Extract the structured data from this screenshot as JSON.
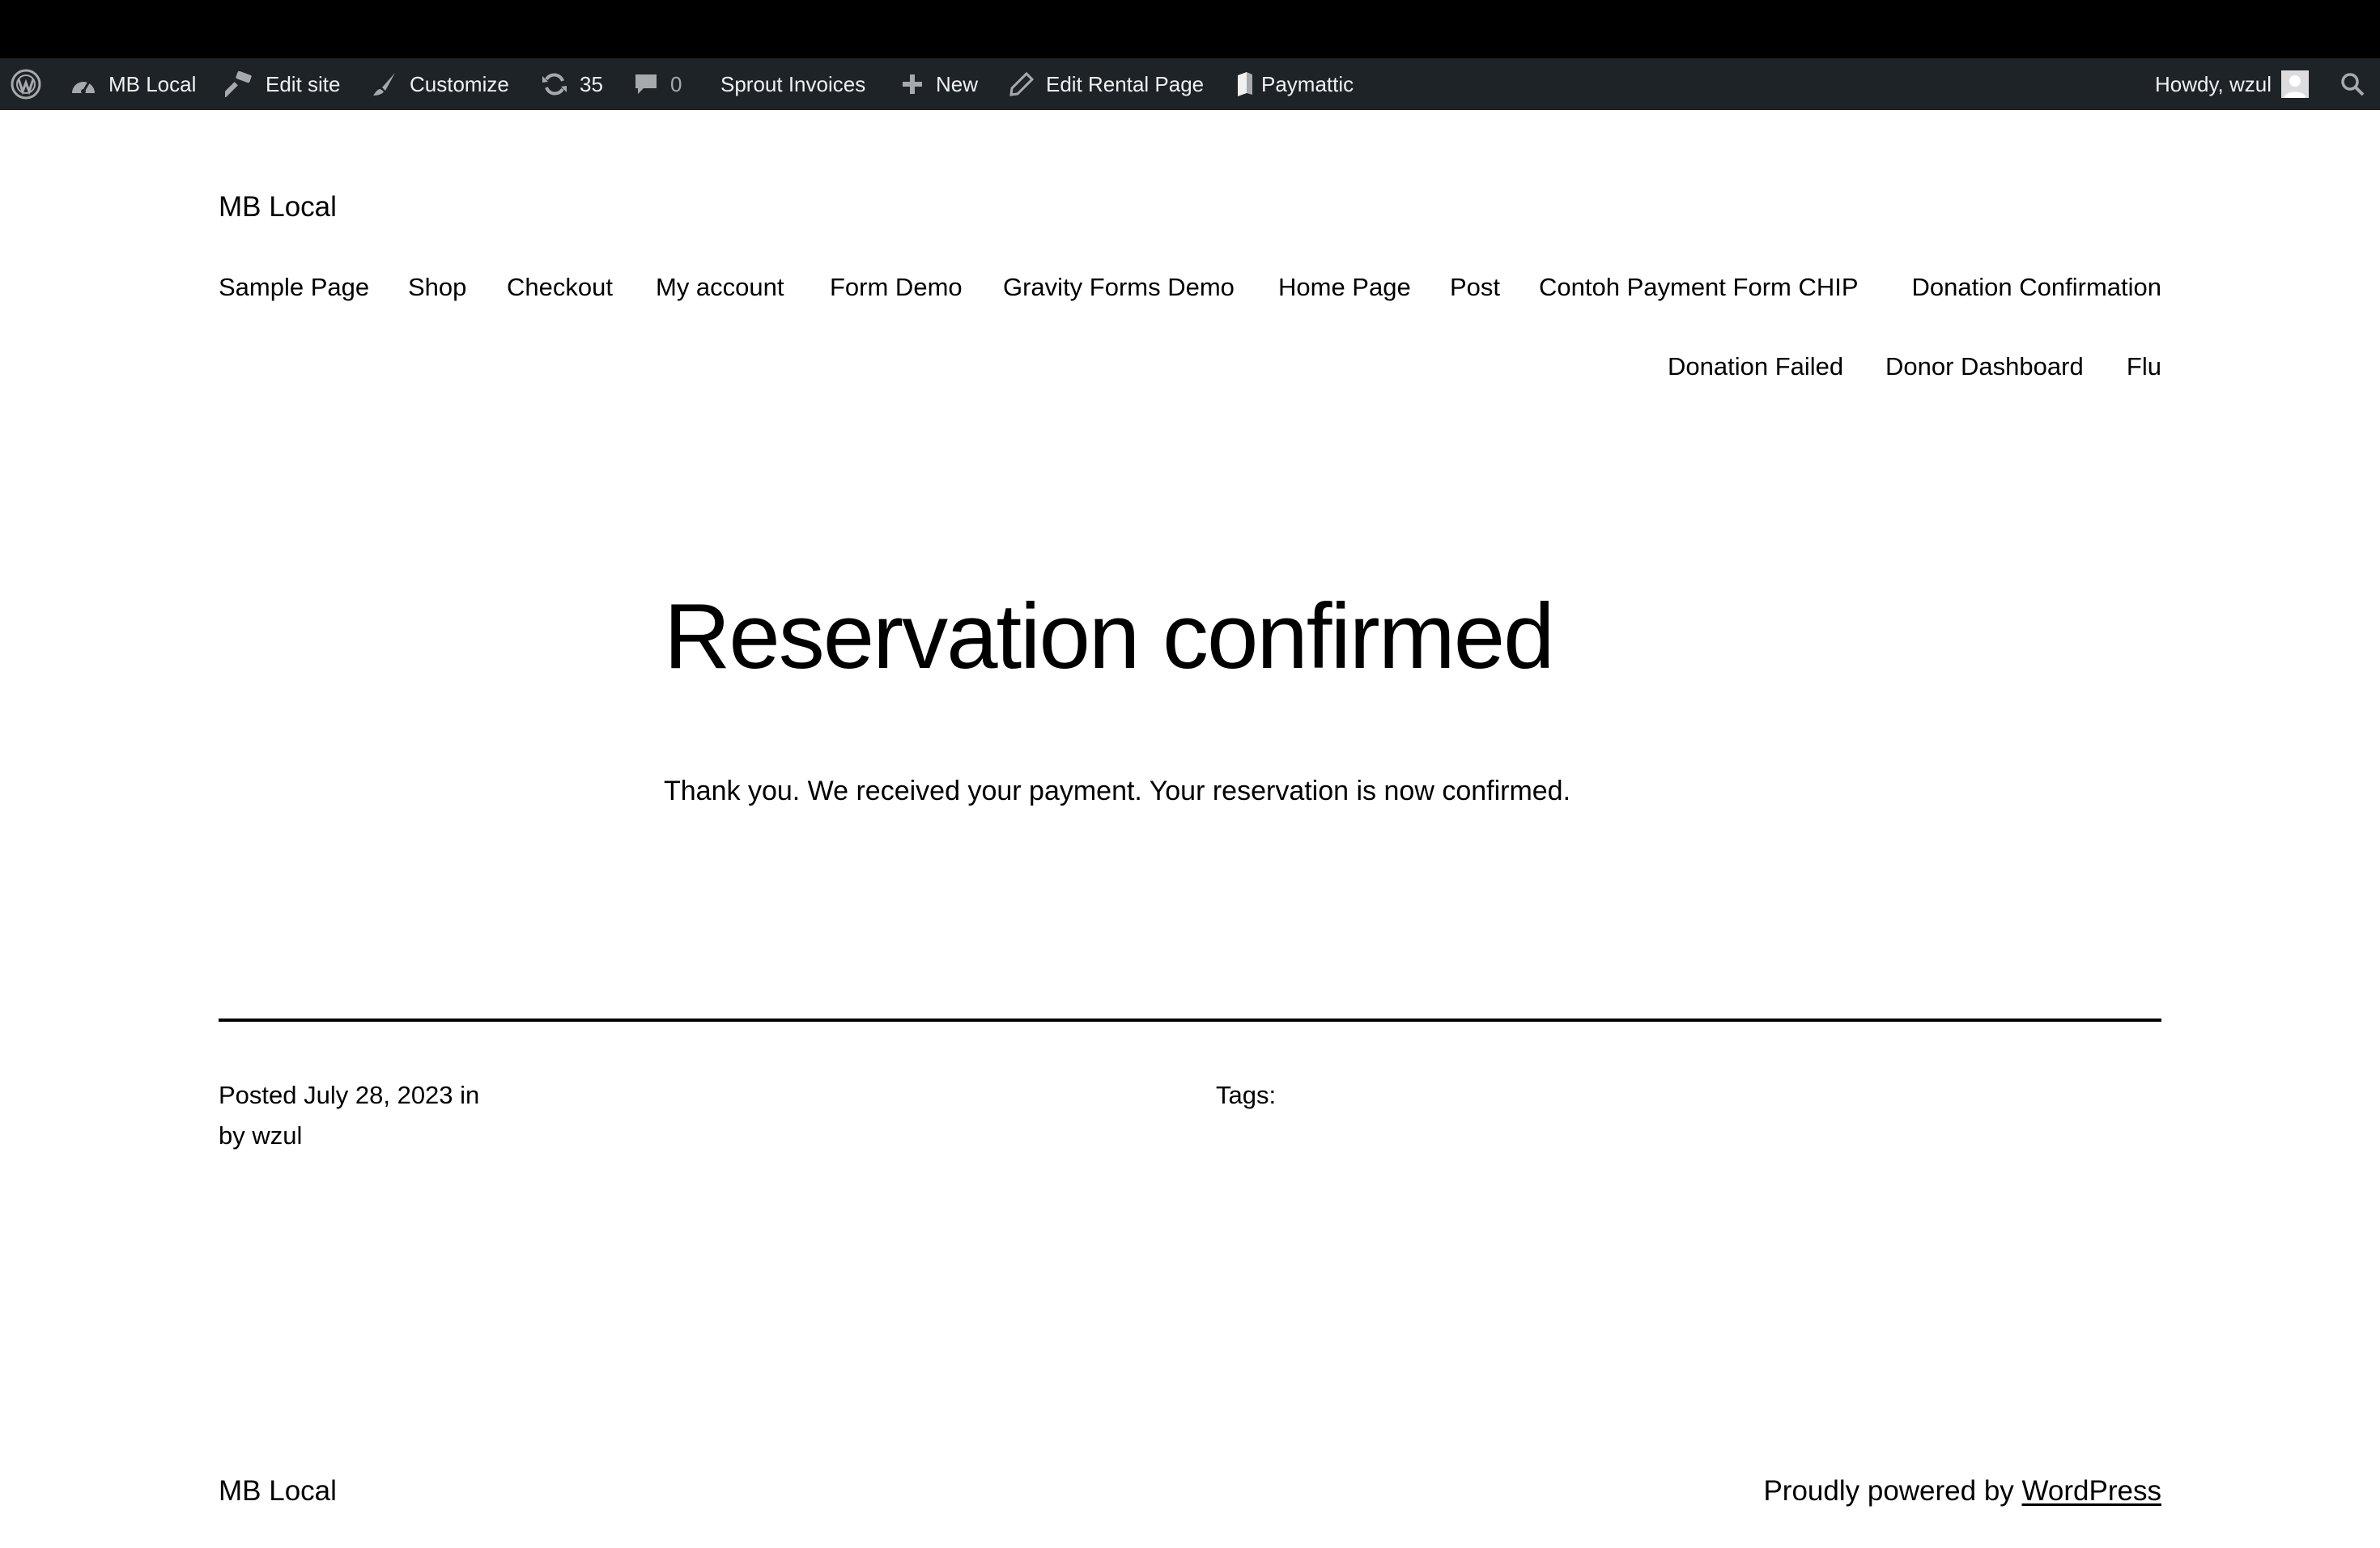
{
  "admin_bar": {
    "site_name": "MB Local",
    "edit_site": "Edit site",
    "customize": "Customize",
    "updates_count": "35",
    "comments_count": "0",
    "sprout_invoices": "Sprout Invoices",
    "new": "New",
    "edit_page": "Edit Rental Page",
    "paymattic": "Paymattic",
    "howdy": "Howdy, wzul"
  },
  "header": {
    "site_title": "MB Local",
    "nav": [
      "Sample Page",
      "Shop",
      "Checkout",
      "My account",
      "Form Demo",
      "Gravity Forms Demo",
      "Home Page",
      "Post",
      "Contoh Payment Form CHIP",
      "Donation Confirmation",
      "Donation Failed",
      "Donor Dashboard",
      "Flu"
    ]
  },
  "main": {
    "title": "Reservation confirmed",
    "body": "Thank you. We received your payment. Your reservation is now confirmed."
  },
  "post_meta": {
    "posted_line": "Posted July 28, 2023 in",
    "by_line": "by wzul",
    "tags_label": "Tags:"
  },
  "footer": {
    "site_title": "MB Local",
    "powered_prefix": "Proudly powered by",
    "powered_link": "WordPress"
  },
  "colors": {
    "admin_bar_bg": "#1d2327",
    "admin_bar_text": "#f0f0f1",
    "admin_bar_muted": "#a7aaad",
    "page_bg": "#ffffff",
    "text": "#000000"
  }
}
